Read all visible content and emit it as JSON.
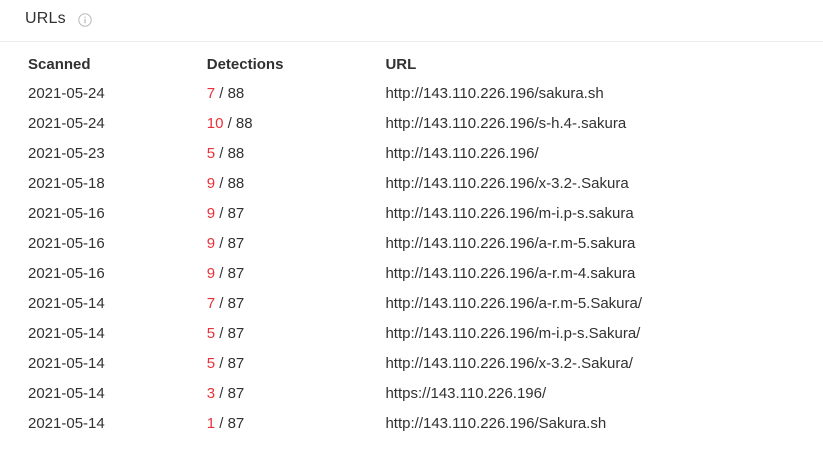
{
  "header": {
    "title": "URLs",
    "info_icon": "info-circle-icon"
  },
  "colors": {
    "text": "#313132",
    "detections_accent": "#e8323a",
    "divider": "#ececec"
  },
  "table": {
    "columns": [
      "Scanned",
      "Detections",
      "URL"
    ],
    "rows": [
      {
        "scanned": "2021-05-24",
        "detections": "7",
        "total": "/ 88",
        "url": "http://143.110.226.196/sakura.sh"
      },
      {
        "scanned": "2021-05-24",
        "detections": "10",
        "total": "/ 88",
        "url": "http://143.110.226.196/s-h.4-.sakura"
      },
      {
        "scanned": "2021-05-23",
        "detections": "5",
        "total": "/ 88",
        "url": "http://143.110.226.196/"
      },
      {
        "scanned": "2021-05-18",
        "detections": "9",
        "total": "/ 88",
        "url": "http://143.110.226.196/x-3.2-.Sakura"
      },
      {
        "scanned": "2021-05-16",
        "detections": "9",
        "total": "/ 87",
        "url": "http://143.110.226.196/m-i.p-s.sakura"
      },
      {
        "scanned": "2021-05-16",
        "detections": "9",
        "total": "/ 87",
        "url": "http://143.110.226.196/a-r.m-5.sakura"
      },
      {
        "scanned": "2021-05-16",
        "detections": "9",
        "total": "/ 87",
        "url": "http://143.110.226.196/a-r.m-4.sakura"
      },
      {
        "scanned": "2021-05-14",
        "detections": "7",
        "total": "/ 87",
        "url": "http://143.110.226.196/a-r.m-5.Sakura/"
      },
      {
        "scanned": "2021-05-14",
        "detections": "5",
        "total": "/ 87",
        "url": "http://143.110.226.196/m-i.p-s.Sakura/"
      },
      {
        "scanned": "2021-05-14",
        "detections": "5",
        "total": "/ 87",
        "url": "http://143.110.226.196/x-3.2-.Sakura/"
      },
      {
        "scanned": "2021-05-14",
        "detections": "3",
        "total": "/ 87",
        "url": "https://143.110.226.196/"
      },
      {
        "scanned": "2021-05-14",
        "detections": "1",
        "total": "/ 87",
        "url": "http://143.110.226.196/Sakura.sh"
      }
    ]
  }
}
